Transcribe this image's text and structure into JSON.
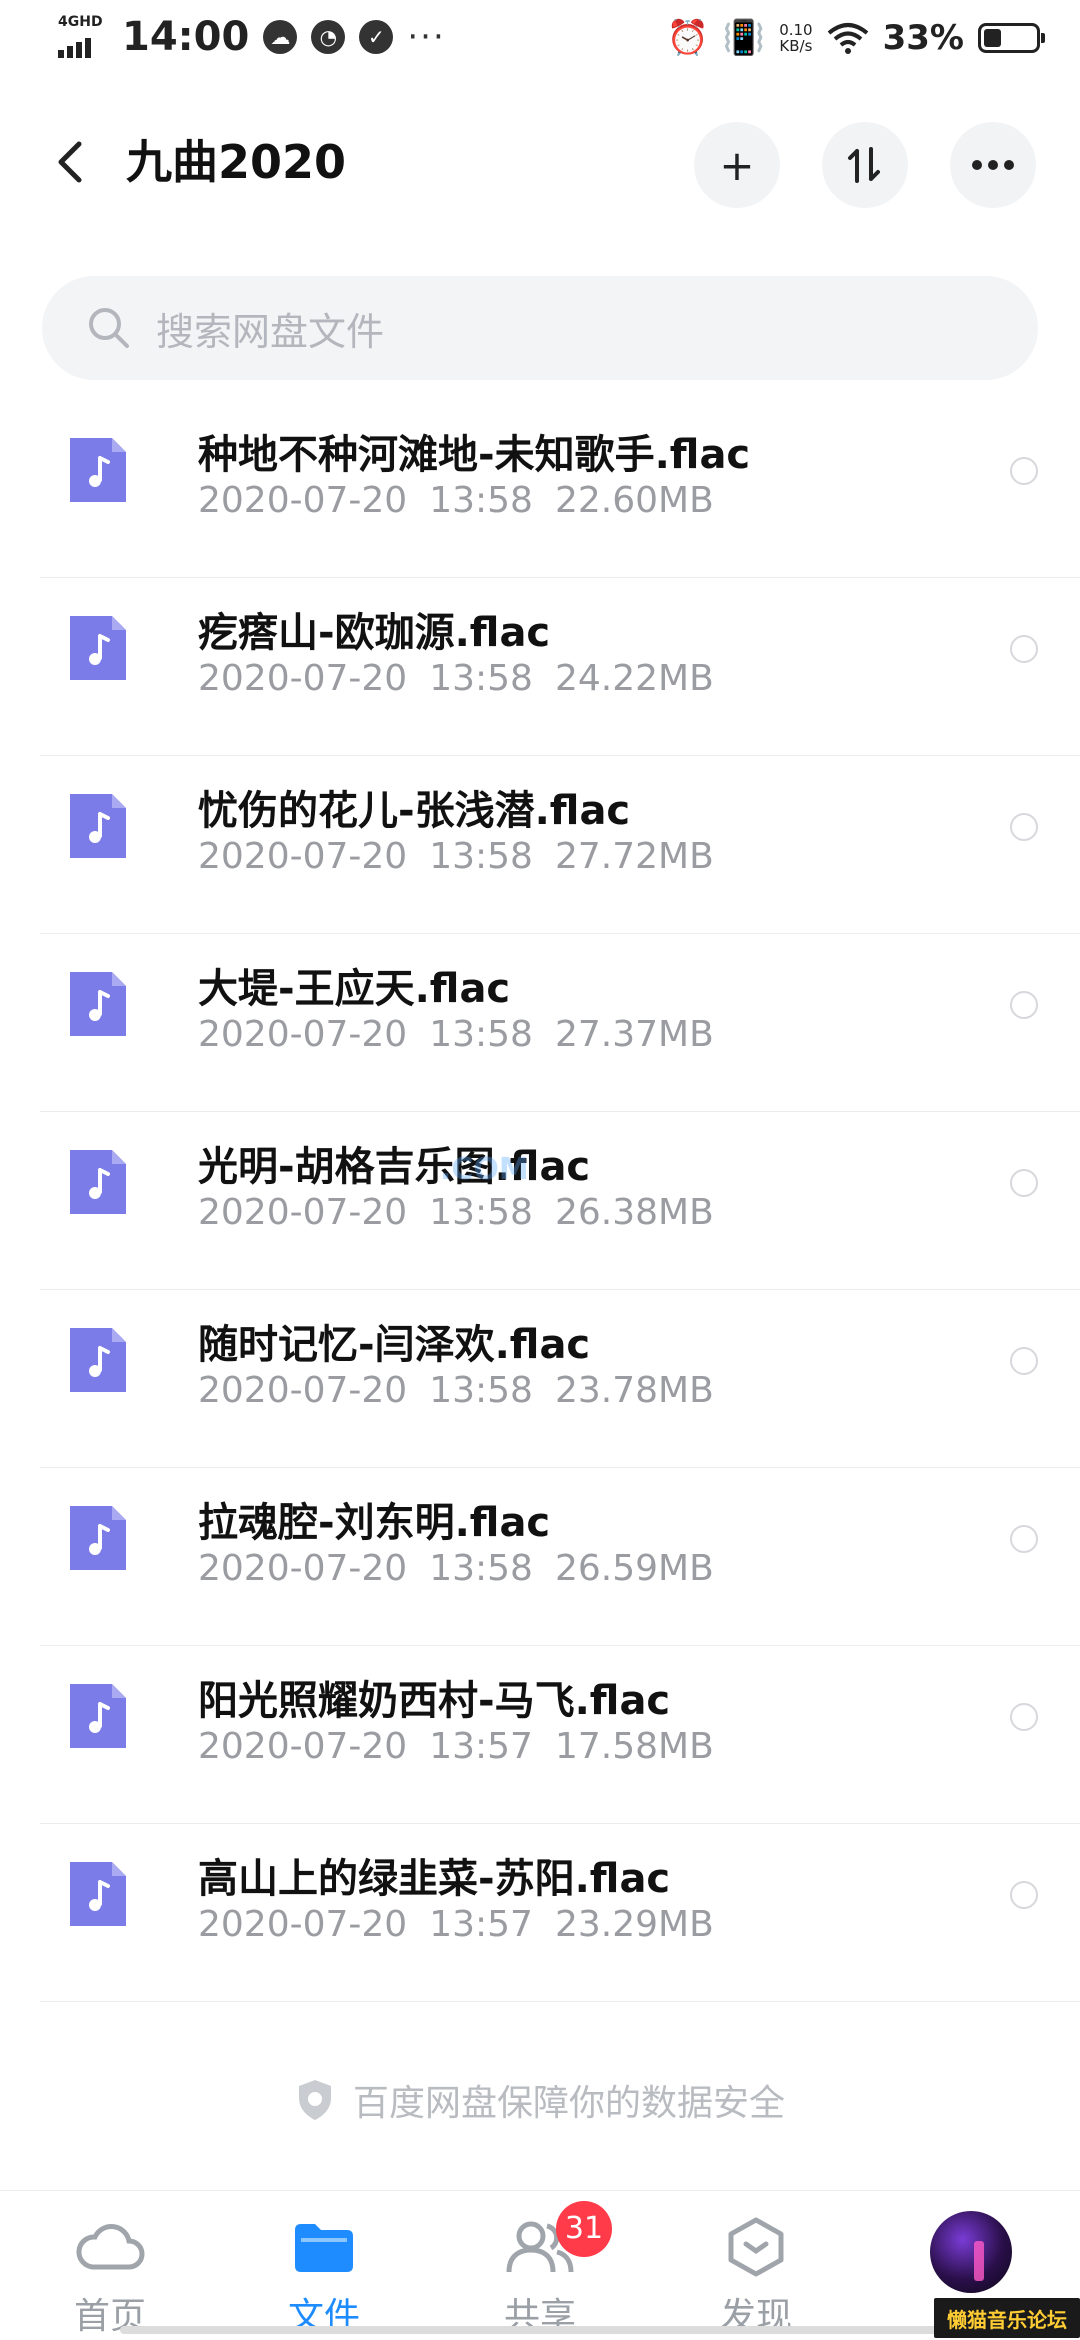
{
  "status_bar": {
    "network": "4GHD",
    "time": "14:00",
    "speed_value": "0.10",
    "speed_unit": "KB/s",
    "battery": "33%",
    "battery_level": 0.33
  },
  "header": {
    "title": "九曲2020"
  },
  "search": {
    "placeholder": "搜索网盘文件"
  },
  "files": [
    {
      "name": "种地不种河滩地-未知歌手.flac",
      "date": "2020-07-20",
      "time": "13:58",
      "size": "22.60MB"
    },
    {
      "name": "疙瘩山-欧珈源.flac",
      "date": "2020-07-20",
      "time": "13:58",
      "size": "24.22MB"
    },
    {
      "name": "忧伤的花儿-张浅潜.flac",
      "date": "2020-07-20",
      "time": "13:58",
      "size": "27.72MB"
    },
    {
      "name": "大堤-王应天.flac",
      "date": "2020-07-20",
      "time": "13:58",
      "size": "27.37MB"
    },
    {
      "name": "光明-胡格吉乐图.flac",
      "date": "2020-07-20",
      "time": "13:58",
      "size": "26.38MB"
    },
    {
      "name": "随时记忆-闫泽欢.flac",
      "date": "2020-07-20",
      "time": "13:58",
      "size": "23.78MB"
    },
    {
      "name": "拉魂腔-刘东明.flac",
      "date": "2020-07-20",
      "time": "13:58",
      "size": "26.59MB"
    },
    {
      "name": "阳光照耀奶西村-马飞.flac",
      "date": "2020-07-20",
      "time": "13:57",
      "size": "17.58MB"
    },
    {
      "name": "高山上的绿韭菜-苏阳.flac",
      "date": "2020-07-20",
      "time": "13:57",
      "size": "23.29MB"
    }
  ],
  "footer_note": "百度网盘保障你的数据安全",
  "nav": {
    "home": "首页",
    "files": "文件",
    "share": "共享",
    "share_badge": "31",
    "discover": "发现"
  },
  "watermark": "懒猫音乐论坛",
  "colors": {
    "accent": "#1e8cff",
    "file_icon": "#7b7ce8",
    "badge": "#ff3b4a"
  }
}
